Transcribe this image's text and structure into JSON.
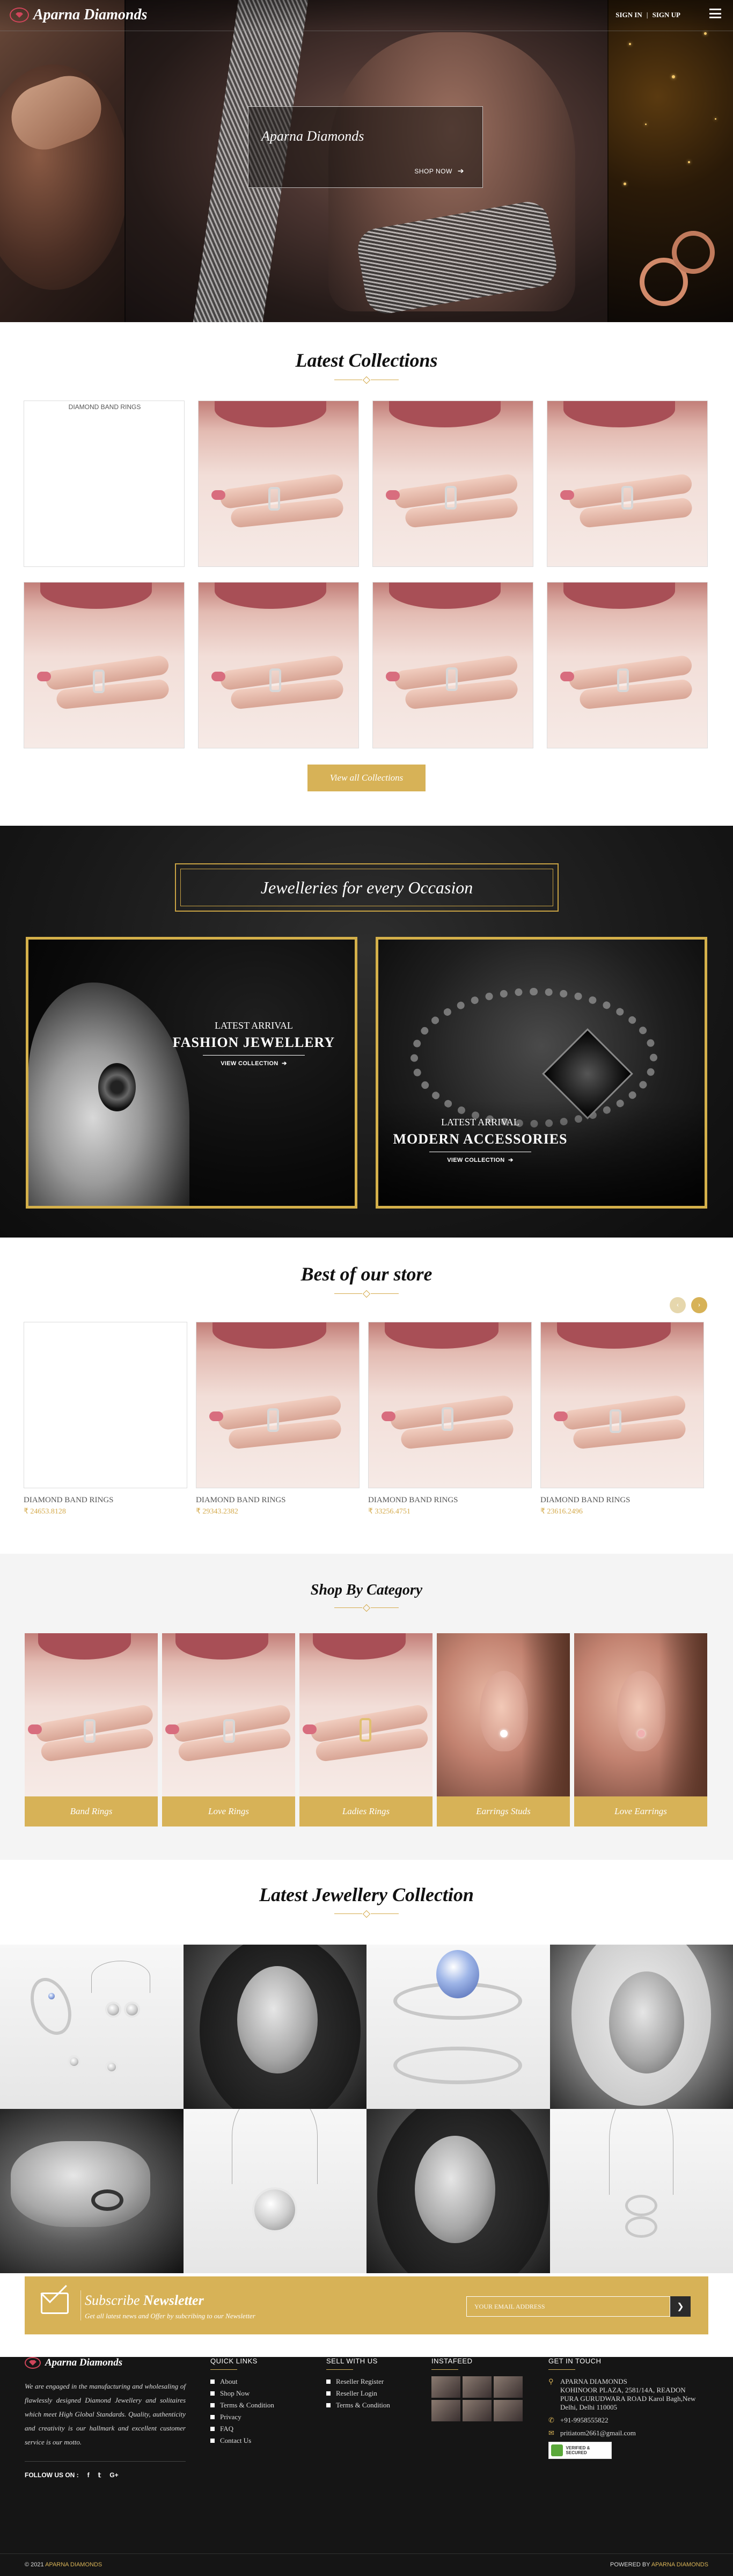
{
  "header": {
    "brand": "Aparna Diamonds",
    "sign_in": "SIGN IN",
    "separator": "|",
    "sign_up": "SIGN UP",
    "menu_icon": "hamburger-menu-icon"
  },
  "hero": {
    "title": "Aparna Diamonds",
    "cta": "SHOP NOW",
    "cta_icon": "arrow-right-icon"
  },
  "latest_collections": {
    "title_bold": "Latest",
    "title_rest": " Collections",
    "broken_image_alt": "DIAMOND BAND RINGS",
    "view_all": "View all Collections"
  },
  "occasion": {
    "title": "Jewelleries for every Occasion",
    "cards": [
      {
        "eyebrow": "LATEST ARRIVAL",
        "heading": "FASHION JEWELLERY",
        "cta": "VIEW COLLECTION"
      },
      {
        "eyebrow": "LATEST ARRIVAL",
        "heading": "MODERN ACCESSORIES",
        "cta": "VIEW COLLECTION"
      }
    ]
  },
  "best_store": {
    "title_bold": "Best",
    "title_rest": " of our store",
    "prev_icon": "chevron-left-icon",
    "next_icon": "chevron-right-icon",
    "products": [
      {
        "name": "DIAMOND BAND RINGS",
        "price": "₹ 24653.8128"
      },
      {
        "name": "DIAMOND BAND RINGS",
        "price": "₹ 29343.2382"
      },
      {
        "name": "DIAMOND BAND RINGS",
        "price": "₹ 33256.4751"
      },
      {
        "name": "DIAMOND BAND RINGS",
        "price": "₹ 23616.2496"
      }
    ]
  },
  "category": {
    "title_bold": "Shop",
    "title_rest": " By Category",
    "items": [
      "Band Rings",
      "Love Rings",
      "Ladies Rings",
      "Earrings Studs",
      "Love Earrings"
    ]
  },
  "jewellery_collection": {
    "title_bold": "Latest",
    "title_rest": " Jewellery Collection"
  },
  "newsletter": {
    "title_a": "Subscribe",
    "title_b": " Newsletter",
    "subtitle": "Get all latest news and Offer by subcribing to our Newsletter",
    "placeholder": "YOUR EMAIL ADDRESS",
    "submit_icon": "chevron-right-icon",
    "mail_icon": "envelope-icon"
  },
  "footer": {
    "brand": "Aparna Diamonds",
    "about": "We are engaged in the manufacturing and wholesaling of flawlessly designed Diamond Jewellery and solitaires which meet High Global Standards. Quality, authenticity and creativity is our hallmark and excellent customer service is our motto.",
    "follow": "FOLLOW US ON :",
    "social_icons": [
      "facebook-icon",
      "twitter-icon",
      "google-plus-icon"
    ],
    "quick_links_title": "QUICK LINKS",
    "quick_links": [
      "About",
      "Shop Now",
      "Terms & Condition",
      "Privacy",
      "FAQ",
      "Contact Us"
    ],
    "sell_title": "SELL WITH US",
    "sell_links": [
      "Reseller Register",
      "Reseller Login",
      "Terms & Condition"
    ],
    "insta_title": "INSTAFEED",
    "touch_title": "GET IN TOUCH",
    "address_lines": [
      "APARNA DIAMONDS",
      "KOHINOOR PLAZA, 2581/14A, READON",
      "PURA GURUDWARA ROAD Karol Bagh,New",
      "Delhi, Delhi 110005"
    ],
    "phone": "+91-9958555822",
    "email": "pritiatom2661@gmail.com",
    "seal_text": "VERIFIED & SECURED",
    "copyright_prefix": "© 2021",
    "copyright_brand": "APARNA DIAMONDS",
    "powered_prefix": "POWERED BY",
    "powered_brand": "APARNA DIAMONDS"
  },
  "colors": {
    "gold": "#d7b257",
    "dark": "#151515",
    "category_bg": "#f4f4f4"
  }
}
